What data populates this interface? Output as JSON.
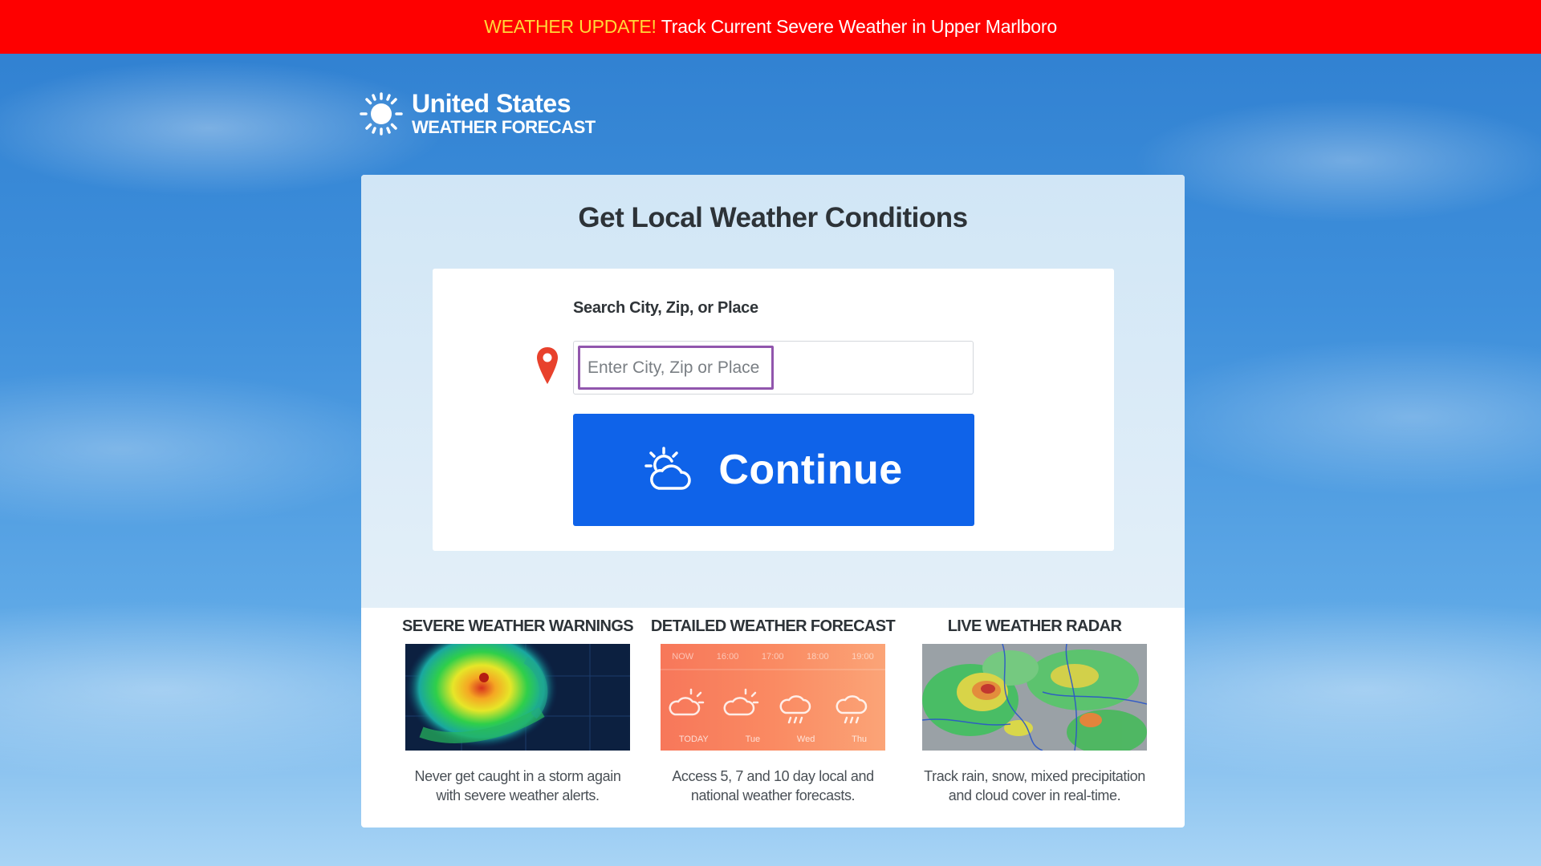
{
  "alert": {
    "highlight": "WEATHER UPDATE!",
    "text": "Track Current Severe Weather in Upper Marlboro"
  },
  "logo": {
    "title": "United States",
    "subtitle": "WEATHER FORECAST",
    "icon": "sun-icon"
  },
  "card": {
    "title": "Get Local Weather Conditions",
    "search_label": "Search City, Zip, or Place",
    "search_placeholder": "Enter City, Zip or Place",
    "search_value": "",
    "continue_label": "Continue",
    "pin_icon": "map-pin-icon",
    "continue_icon": "sun-cloud-icon"
  },
  "features": [
    {
      "title": "SEVERE WEATHER WARNINGS",
      "desc_line1": "Never get caught in a storm again",
      "desc_line2": "with severe weather alerts."
    },
    {
      "title": "DETAILED WEATHER FORECAST",
      "desc_line1": "Access 5, 7 and 10 day local and",
      "desc_line2": "national weather forecasts.",
      "forecast_times": [
        "NOW",
        "16:00",
        "17:00",
        "18:00",
        "19:00"
      ],
      "forecast_days": [
        "TODAY",
        "Tue",
        "Wed",
        "Thu"
      ]
    },
    {
      "title": "LIVE WEATHER RADAR",
      "desc_line1": "Track rain, snow, mixed precipitation",
      "desc_line2": "and cloud cover in real-time."
    }
  ],
  "colors": {
    "alert_bg": "#fe0000",
    "alert_highlight": "#ffd83a",
    "button": "#0f63e9",
    "input_focus": "#9156ad",
    "pin": "#e8412c"
  }
}
